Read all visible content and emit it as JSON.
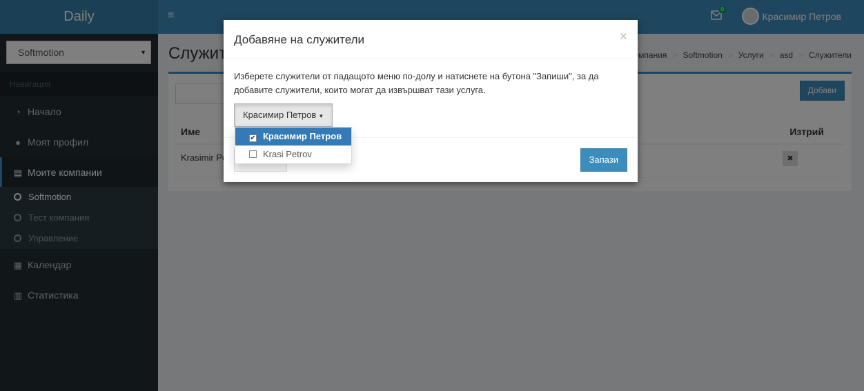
{
  "app": {
    "name": "Daily"
  },
  "header": {
    "menu_icon": "hamburger-icon",
    "mail_icon": "envelope-icon",
    "mail_count": "0",
    "user_name": "Красимир Петров"
  },
  "sidebar": {
    "company_select": "Softmotion",
    "nav_header": "Навигация",
    "items": [
      {
        "label": "Начало",
        "icon": "dashboard-icon"
      },
      {
        "label": "Моят профил",
        "icon": "user-icon"
      },
      {
        "label": "Моите компании",
        "icon": "building-icon"
      },
      {
        "label": "Календар",
        "icon": "calendar-icon"
      },
      {
        "label": "Статистика",
        "icon": "bar-chart-icon"
      }
    ],
    "companies": [
      {
        "label": "Softmotion"
      },
      {
        "label": "Тест компания"
      },
      {
        "label": "Управление"
      }
    ]
  },
  "page": {
    "title": "Служители",
    "breadcrumb": [
      "Компания",
      "Softmotion",
      "Услуги",
      "asd",
      "Служители"
    ],
    "add_button": "Добави",
    "table": {
      "headers": {
        "name": "Име",
        "delete": "Изтрий"
      },
      "rows": [
        {
          "name": "Krasimir Petrov"
        }
      ]
    }
  },
  "modal": {
    "title": "Добавяне на служители",
    "close": "×",
    "description": "Изберете служители от падащото меню по-долу и натиснете на бутона \"Запиши\", за да добавите служители, които могат да извършват тази услуга.",
    "multiselect_label": "Красимир Петров",
    "options": [
      {
        "label": "Красимир Петров",
        "checked": true
      },
      {
        "label": "Krasi Petrov",
        "checked": false
      }
    ],
    "save_button": "Запази"
  },
  "colors": {
    "header": "#3c8dbc",
    "logo": "#367fa9",
    "sidebar": "#222d32",
    "primary": "#3c8dbc",
    "selected_option": "#337ab7"
  }
}
